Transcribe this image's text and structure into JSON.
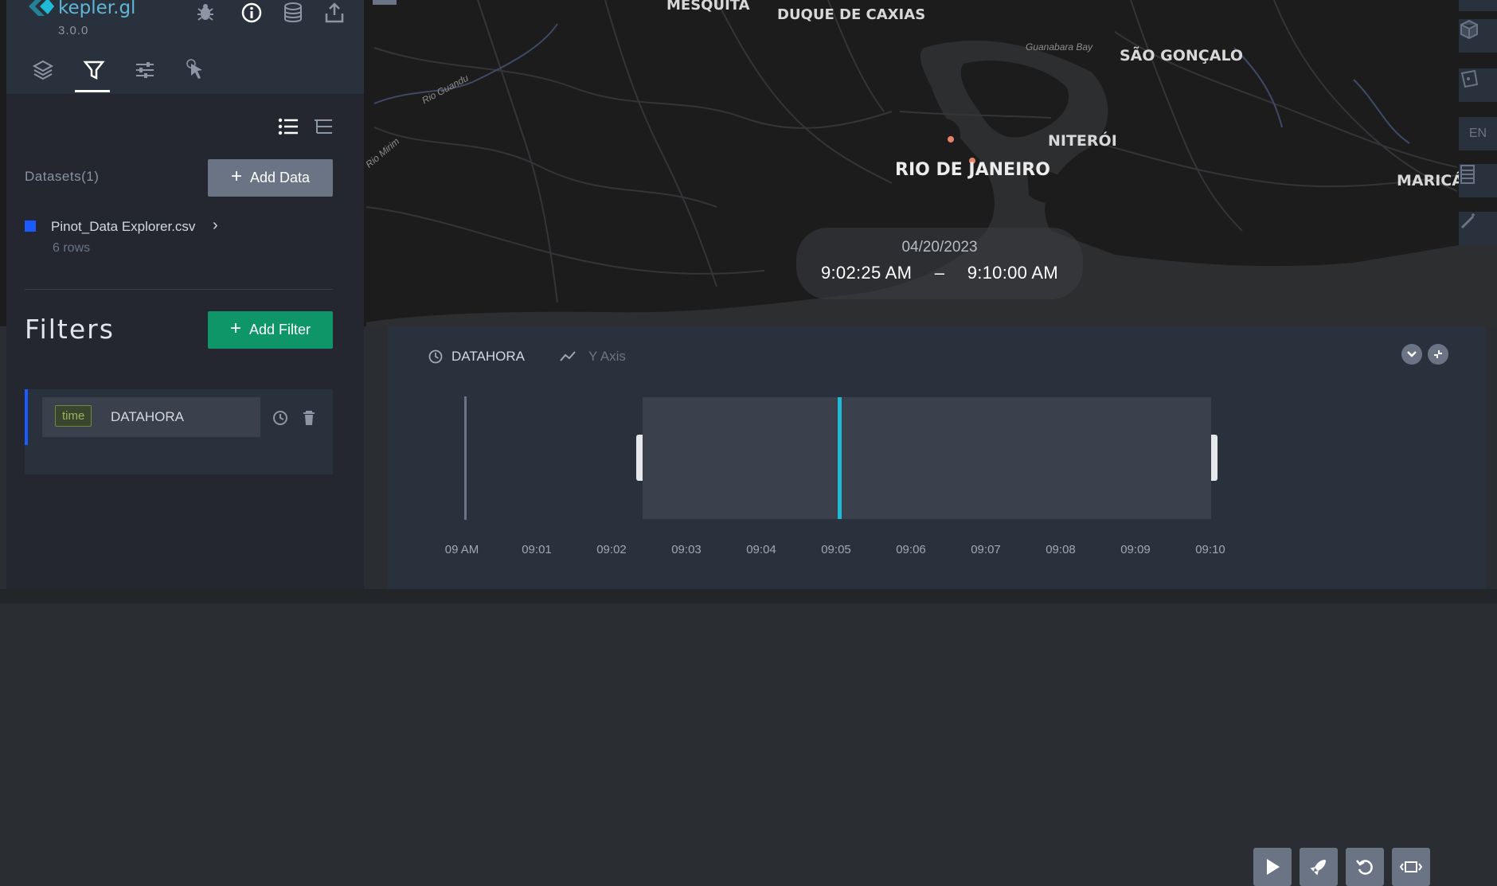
{
  "app": {
    "name": "kepler.gl",
    "version": "3.0.0"
  },
  "map": {
    "cities": [
      {
        "name": "MESQUITA"
      },
      {
        "name": "DUQUE DE CAXIAS"
      },
      {
        "name": "SÃO GONÇALO"
      },
      {
        "name": "NITERÓI"
      },
      {
        "name": "RIO DE JANEIRO"
      },
      {
        "name": "MARICÁ"
      }
    ],
    "water_labels": [
      "Guanabara Bay",
      "Rio Guandu",
      "Rio Mirim"
    ],
    "time_overlay": {
      "date": "04/20/2023",
      "start": "9:02:25 AM",
      "separator": "–",
      "end": "9:10:00 AM"
    },
    "right_toolbar": {
      "language": "EN"
    }
  },
  "side_panel": {
    "header_icons": [
      "bug-icon",
      "info-icon",
      "database-icon",
      "share-icon"
    ],
    "tabs": [
      "layers-icon",
      "filter-icon",
      "sliders-icon",
      "interaction-icon"
    ],
    "active_tab": "filter",
    "datasets_label": "Datasets(1)",
    "add_data_label": "Add Data",
    "dataset": {
      "name": "Pinot_Data Explorer.csv",
      "rows": "6 rows",
      "color": "#1a5bff"
    },
    "filters_title": "Filters",
    "add_filter_label": "Add Filter",
    "filter": {
      "type_badge": "time",
      "field": "DATAHORA"
    }
  },
  "timeline": {
    "field_label": "DATAHORA",
    "y_axis_label": "Y Axis",
    "ticks": [
      "09 AM",
      "09:01",
      "09:02",
      "09:03",
      "09:04",
      "09:05",
      "09:06",
      "09:07",
      "09:08",
      "09:09",
      "09:10"
    ],
    "controls": [
      "play-icon",
      "speed-icon",
      "reset-icon",
      "window-icon"
    ],
    "selection": {
      "start": "9:02:25 AM",
      "end": "9:10:00 AM"
    },
    "colors": {
      "accent": "#1fbad6",
      "selection": "#3a414c"
    }
  }
}
